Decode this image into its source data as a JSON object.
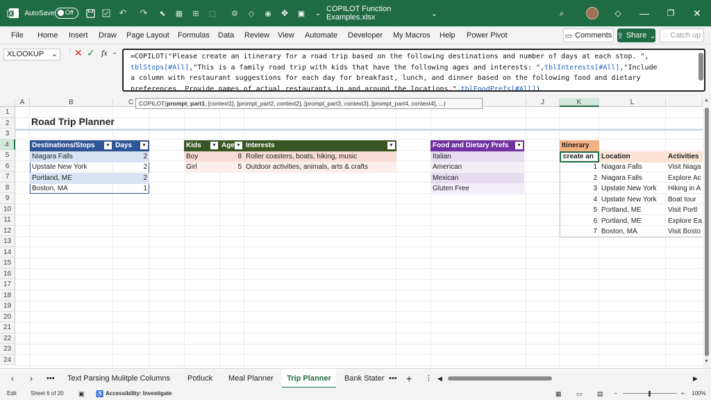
{
  "titlebar": {
    "autosave_label": "AutoSave",
    "autosave_state": "Off",
    "file_name": "COPILOT Function Examples.xlsx"
  },
  "menu": {
    "items": [
      "File",
      "Home",
      "Insert",
      "Draw",
      "Page Layout",
      "Formulas",
      "Data",
      "Review",
      "View",
      "Automate",
      "Developer",
      "My Macros",
      "Help",
      "Power Pivot"
    ],
    "comments": "Comments",
    "share": "Share",
    "catchup": "Catch up"
  },
  "formula_bar": {
    "name_box": "XLOOKUP",
    "fx": "fx",
    "f1": "=COPILOT(\"Please create an itinerary for a road trip based on the following destinations and number of days at each stop. \",",
    "f2a": "tblStops[#All]",
    "f2b": ",\"This is a family road trip with kids that have the following ages and interests: \",",
    "f2c": "tblInterests[#All]",
    "f2d": ",\"Include",
    "f3": "a column with restaurant suggestions for each day for breakfast, lunch, and dinner based on the following food and dietary",
    "f4a": "preferences. Provide names of actual restaurants in and around the locations.\",",
    "f4b": "tblFoodPrefs[#All]",
    "f4c": ")",
    "tooltip_fn": "COPILOT(",
    "tooltip_bold": "prompt_part1",
    "tooltip_rest": ", [context1], [prompt_part2, context2], [prompt_part3, context3], [prompt_part4, context4], ...)"
  },
  "columns": [
    "A",
    "B",
    "C",
    "J",
    "K",
    "L"
  ],
  "rows": [
    "1",
    "2",
    "3",
    "4",
    "5",
    "6",
    "7",
    "8",
    "9",
    "10",
    "11",
    "12",
    "13",
    "14",
    "15",
    "16",
    "17",
    "18",
    "19",
    "20",
    "21",
    "22",
    "23",
    "24"
  ],
  "sheet": {
    "title": "Road Trip Planner",
    "stops": {
      "headers": [
        "Destinations/Stops",
        "Days"
      ],
      "rows": [
        [
          "Niagara Falls",
          "2"
        ],
        [
          "Upstate New York",
          "2"
        ],
        [
          "Portland, ME",
          "2"
        ],
        [
          "Boston, MA",
          "1"
        ]
      ]
    },
    "interests": {
      "headers": [
        "Kids",
        "Age",
        "Interests"
      ],
      "rows": [
        [
          "Boy",
          "8",
          "Roller coasters, boats, hiking, music"
        ],
        [
          "Girl",
          "5",
          "Outdoor activities, animals, arts & crafts"
        ]
      ]
    },
    "food": {
      "header": "Food and Dietary Prefs",
      "rows": [
        "Italian",
        "American",
        "Mexican",
        "Gluten Free"
      ]
    },
    "itinerary": {
      "title": "Itinerary",
      "active_cell": "create an",
      "headers": [
        "Location",
        "Activities"
      ],
      "rows": [
        [
          "1",
          "Niagara Falls",
          "Visit Niaga"
        ],
        [
          "2",
          "Niagara Falls",
          "Explore Ac"
        ],
        [
          "3",
          "Upstate New York",
          "Hiking in A"
        ],
        [
          "4",
          "Upstate New York",
          "Boat tour"
        ],
        [
          "5",
          "Portland, ME",
          "Visit Portl"
        ],
        [
          "6",
          "Portland, ME",
          "Explore Ea"
        ],
        [
          "7",
          "Boston, MA",
          "Visit Bosto"
        ]
      ]
    }
  },
  "tabs": [
    "Text Parsing Mulitple Columns",
    "Potluck",
    "Meal Planner",
    "Trip Planner",
    "Bank Staten"
  ],
  "status": {
    "mode": "Edit",
    "sheet_of": "Sheet 6 of 20",
    "accessibility": "Accessibility: Investigate",
    "zoom": "100%"
  },
  "colors": {
    "title_bar": "#1f6b43",
    "stops_header": "#2f5597",
    "interests_header": "#375623",
    "food_header": "#7030a0",
    "itinerary_header": "#f4b183"
  }
}
